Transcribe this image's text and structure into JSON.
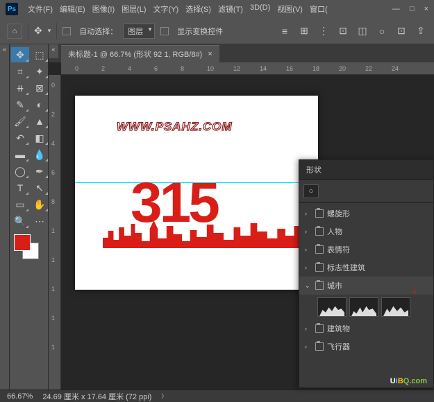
{
  "app": {
    "logo": "Ps"
  },
  "menu": [
    "文件(F)",
    "编辑(E)",
    "图像(I)",
    "图层(L)",
    "文字(Y)",
    "选择(S)",
    "滤镜(T)",
    "3D(D)",
    "视图(V)",
    "窗口("
  ],
  "win": {
    "min": "—",
    "max": "□",
    "close": "×"
  },
  "options": {
    "auto_select": "自动选择：",
    "dropdown": "图层",
    "transform": "显示变换控件"
  },
  "tab": {
    "title": "未标题-1 @ 66.7% (形状 92 1, RGB/8#)",
    "close": "×"
  },
  "ruler_h": [
    "0",
    "2",
    "4",
    "6",
    "8",
    "10",
    "12",
    "14",
    "16",
    "18",
    "20",
    "22",
    "24"
  ],
  "ruler_v": [
    "0",
    "2",
    "4",
    "6",
    "8",
    "1",
    "1",
    "1",
    "1",
    "1"
  ],
  "canvas": {
    "watermark": "WWW.PSAHZ.COM",
    "big": "315"
  },
  "panel": {
    "title": "形状",
    "items": [
      {
        "label": "螺旋形",
        "open": false
      },
      {
        "label": "人物",
        "open": false
      },
      {
        "label": "表情符",
        "open": false
      },
      {
        "label": "标志性建筑",
        "open": false
      },
      {
        "label": "城市",
        "open": true
      },
      {
        "label": "建筑物",
        "open": false
      },
      {
        "label": "飞行器",
        "open": false
      }
    ]
  },
  "status": {
    "zoom": "66.67%",
    "dims": "24.69 厘米 x 17.64 厘米 (72 ppi)"
  },
  "swatch_fg": "#d91e18",
  "brand": {
    "u": "U",
    "i": "i",
    "b": "B",
    "q": "Q.com"
  }
}
